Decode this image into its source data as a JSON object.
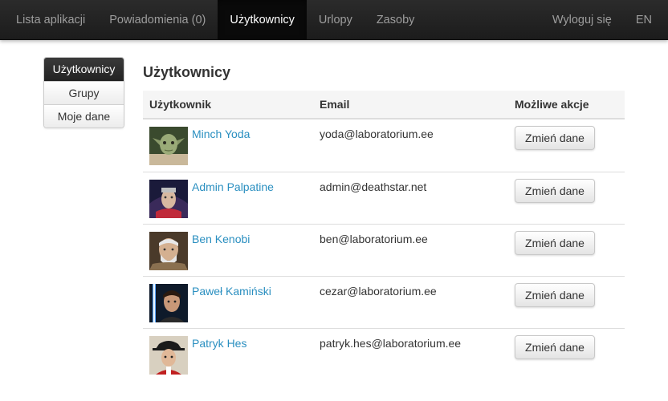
{
  "navbar": {
    "left_items": [
      {
        "label": "Lista aplikacji"
      },
      {
        "label": "Powiadomienia (0)"
      },
      {
        "label": "Użytkownicy",
        "active": true
      },
      {
        "label": "Urlopy"
      },
      {
        "label": "Zasoby"
      }
    ],
    "logout_label": "Wyloguj się",
    "language_label": "EN"
  },
  "sidebar": {
    "items": [
      {
        "label": "Użytkownicy",
        "active": true
      },
      {
        "label": "Grupy"
      },
      {
        "label": "Moje dane"
      }
    ]
  },
  "main": {
    "title": "Użytkownicy",
    "table": {
      "headers": {
        "user": "Użytkownik",
        "email": "Email",
        "actions": "Możliwe akcje"
      },
      "rows": [
        {
          "name": "Minch Yoda",
          "email": "yoda@laboratorium.ee",
          "action_label": "Zmień dane",
          "avatar_icon": "yoda-avatar-icon"
        },
        {
          "name": "Admin Palpatine",
          "email": "admin@deathstar.net",
          "action_label": "Zmień dane",
          "avatar_icon": "palpatine-avatar-icon"
        },
        {
          "name": "Ben Kenobi",
          "email": "ben@laboratorium.ee",
          "action_label": "Zmień dane",
          "avatar_icon": "kenobi-avatar-icon"
        },
        {
          "name": "Paweł Kamiński",
          "email": "cezar@laboratorium.ee",
          "action_label": "Zmień dane",
          "avatar_icon": "kaminski-avatar-icon"
        },
        {
          "name": "Patryk Hes",
          "email": "patryk.hes@laboratorium.ee",
          "action_label": "Zmień dane",
          "avatar_icon": "hes-avatar-icon"
        }
      ]
    }
  },
  "colors": {
    "navbar_bg": "#222222",
    "nav_text": "#9d9d9d",
    "link": "#2a8fc0",
    "table_header_bg": "#f5f5f5"
  }
}
